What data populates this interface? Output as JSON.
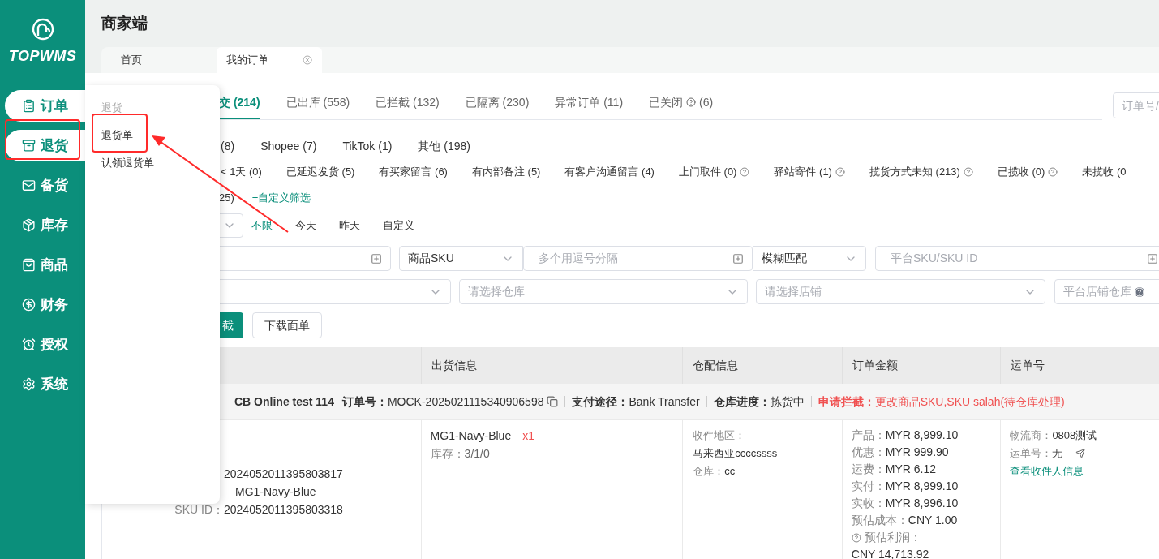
{
  "sidebar": {
    "logo": "TOPWMS",
    "items": [
      {
        "label": "订单",
        "active": true
      },
      {
        "label": "退货",
        "active": true
      },
      {
        "label": "备货",
        "active": false
      },
      {
        "label": "库存",
        "active": false
      },
      {
        "label": "商品",
        "active": false
      },
      {
        "label": "财务",
        "active": false
      },
      {
        "label": "授权",
        "active": false
      },
      {
        "label": "系统",
        "active": false
      }
    ]
  },
  "header": {
    "title": "商家端"
  },
  "page_tabs": [
    {
      "label": "首页",
      "selected": false
    },
    {
      "label": "我的订单",
      "selected": true
    }
  ],
  "popup_menu": {
    "heading": "退货",
    "items": [
      "退货单",
      "认领退货单"
    ]
  },
  "status_tabs": [
    {
      "label": "交 (214)",
      "selected": true,
      "help": false
    },
    {
      "label": "已出库 (558)",
      "selected": false,
      "help": false
    },
    {
      "label": "已拦截 (132)",
      "selected": false,
      "help": false
    },
    {
      "label": "已隔离 (230)",
      "selected": false,
      "help": false
    },
    {
      "label": "异常订单 (11)",
      "selected": false,
      "help": false
    },
    {
      "label": "已关闭",
      "count": "(6)",
      "selected": false,
      "help": true
    }
  ],
  "order_search": {
    "placeholder": "订单号/"
  },
  "platform_filters": [
    "(8)",
    "Shopee (7)",
    "TikTok (1)",
    "其他 (198)"
  ],
  "quick_filters": [
    {
      "label": "< 1天 (0)",
      "help": false
    },
    {
      "label": "已延迟发货 (5)",
      "help": false
    },
    {
      "label": "有买家留言 (6)",
      "help": false
    },
    {
      "label": "有内部备注 (5)",
      "help": false
    },
    {
      "label": "有客户沟通留言 (4)",
      "help": false
    },
    {
      "label": "上门取件 (0)",
      "help": true
    },
    {
      "label": "驿站寄件 (1)",
      "help": true
    },
    {
      "label": "揽货方式未知 (213)",
      "help": true
    },
    {
      "label": "已揽收 (0)",
      "help": true
    },
    {
      "label": "未揽收 (0",
      "help": false
    }
  ],
  "custom_filter": {
    "count": "25)",
    "link": "+自定义筛选"
  },
  "date_filters": [
    {
      "label": "不限",
      "selected": true
    },
    {
      "label": "今天",
      "selected": false
    },
    {
      "label": "昨天",
      "selected": false
    },
    {
      "label": "自定义",
      "selected": false
    }
  ],
  "search_rows": [
    [
      {
        "kind": "multi_input"
      },
      {
        "kind": "select",
        "value": "商品SKU"
      },
      {
        "kind": "multi_input",
        "placeholder": "多个用逗号分隔"
      },
      {
        "kind": "select",
        "value": "模糊匹配"
      },
      {
        "kind": "multi_input",
        "placeholder": "平台SKU/SKU ID"
      }
    ],
    [
      {
        "kind": "select"
      },
      {
        "kind": "select",
        "placeholder": "请选择仓库"
      },
      {
        "kind": "select",
        "placeholder": "请选择店铺"
      },
      {
        "kind": "help_input",
        "placeholder": "平台店铺仓库"
      }
    ]
  ],
  "actions": [
    {
      "label": "截",
      "primary": true
    },
    {
      "label": "下载面单",
      "primary": false
    }
  ],
  "table": {
    "columns": [
      "出货信息",
      "仓配信息",
      "订单金额",
      "运单号"
    ],
    "order": {
      "store": "CB Online test 114",
      "order_no_label": "订单号：",
      "order_no": "MOCK-2025021115340906598",
      "payment_label": "支付途径：",
      "payment": "Bank Transfer",
      "progress_label": "仓库进度：",
      "progress": "拣货中",
      "intercept_label": "申请拦截：",
      "intercept": "更改商品SKU,SKU salah(待仓库处理)"
    },
    "product": [
      {
        "value": "2024052011395803817"
      },
      {
        "value": "MG1-Navy-Blue"
      },
      {
        "label": "SKU ID：",
        "value": "2024052011395803318"
      }
    ],
    "shipment": {
      "sku": "MG1-Navy-Blue",
      "qty": "x1",
      "stock_label": "库存：",
      "stock": "3/1/0"
    },
    "warehouse": {
      "region_label": "收件地区：",
      "region": "马来西亚ccccssss",
      "warehouse_label": "仓库：",
      "warehouse": "cc"
    },
    "amounts": [
      {
        "label": "产品：",
        "value": "MYR 8,999.10",
        "help": false
      },
      {
        "label": "优惠：",
        "value": "MYR 999.90",
        "help": false
      },
      {
        "label": "运费：",
        "value": "MYR 6.12",
        "help": false
      },
      {
        "label": "实付：",
        "value": "MYR 8,999.10",
        "help": false
      },
      {
        "label": "实收：",
        "value": "MYR 8,996.10",
        "help": false
      },
      {
        "label": "预估成本：",
        "value": "CNY 1.00",
        "help": false
      },
      {
        "label": "预估利润：",
        "help": true
      },
      {
        "value": "CNY 14,713.92",
        "help": false
      }
    ],
    "waybill": {
      "carrier_label": "物流商：",
      "carrier": "0808测试",
      "waybill_label": "运单号：",
      "waybill": "无",
      "link": "查看收件人信息"
    }
  }
}
